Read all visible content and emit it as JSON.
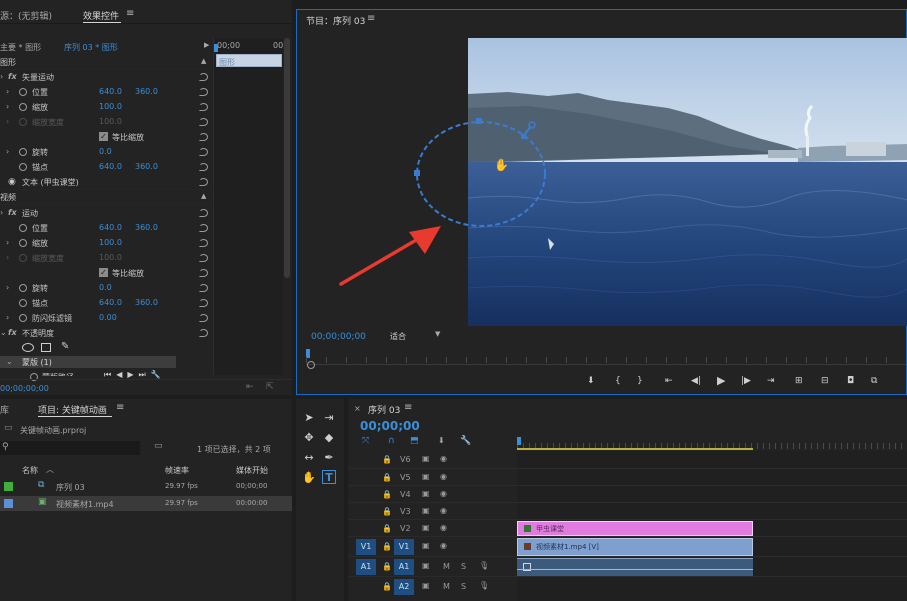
{
  "colors": {
    "bg": "#1d1d1d",
    "panel": "#232323",
    "accent_blue": "#3b8fd9",
    "clip_pink": "#e07ce0",
    "clip_blue": "#7f9fcf",
    "arrow_red": "#e83a2e",
    "selection_outline": "#1c6bc2"
  },
  "source_panel": {
    "tab_source": "源：(无剪辑)",
    "tab_effect_controls": "效果控件",
    "breadcrumb_main": "主要 * 图形",
    "breadcrumb_seq": "序列 03 * 图形",
    "ruler_start": "00;00",
    "ruler_end": "00",
    "clip_label": "图形",
    "section_graphic": "图形",
    "vector_motion": {
      "label": "矢量运动",
      "position_label": "位置",
      "position_x": "640.0",
      "position_y": "360.0",
      "scale_label": "缩放",
      "scale_value": "100.0",
      "scale_width_label": "缩放宽度",
      "scale_width_value": "100.0",
      "uniform_scale_label": "等比缩放",
      "rotation_label": "旋转",
      "rotation_value": "0.0",
      "anchor_label": "锚点",
      "anchor_x": "640.0",
      "anchor_y": "360.0"
    },
    "text_layer": "文本 (甲虫课堂)",
    "section_video": "视频",
    "motion": {
      "label": "运动",
      "position_label": "位置",
      "position_x": "640.0",
      "position_y": "360.0",
      "scale_label": "缩放",
      "scale_value": "100.0",
      "scale_width_label": "缩放宽度",
      "scale_width_value": "100.0",
      "uniform_scale_label": "等比缩放",
      "rotation_label": "旋转",
      "rotation_value": "0.0",
      "anchor_label": "锚点",
      "anchor_x": "640.0",
      "anchor_y": "360.0",
      "flicker_label": "防闪烁滤镜",
      "flicker_value": "0.00"
    },
    "opacity_label": "不透明度",
    "mask_label": "蒙版 (1)",
    "mask_path_label": "蒙版路径",
    "timecode": "00;00;00;00"
  },
  "program_panel": {
    "title": "节目：序列 03",
    "timecode": "00;00;00;00",
    "fit_option": "适合"
  },
  "project_panel": {
    "tab_lib": "库",
    "tab_project": "项目: 关键帧动画",
    "project_file": "关键帧动画.prproj",
    "selection_info": "1 项已选择，共 2 项",
    "col_name": "名称",
    "col_fps": "帧速率",
    "col_start": "媒体开始",
    "items": [
      {
        "name": "序列 03",
        "fps": "29.97 fps",
        "start": "00;00;00",
        "color": "#3fae3f"
      },
      {
        "name": "视频素材1.mp4",
        "fps": "29.97 fps",
        "start": "00:00:00",
        "color": "#5b8fd6"
      }
    ]
  },
  "timeline_panel": {
    "title": "序列 03",
    "timecode": "00;00;00",
    "tracks": [
      {
        "label": "V6"
      },
      {
        "label": "V5"
      },
      {
        "label": "V4"
      },
      {
        "label": "V3"
      },
      {
        "label": "V2"
      },
      {
        "label": "V1"
      },
      {
        "label": "A1"
      },
      {
        "label": "A2"
      }
    ],
    "source_v1": "V1",
    "source_a1": "A1",
    "clip_v2": "甲虫课堂",
    "clip_v1": "视频素材1.mp4 [V]",
    "btn_m": "M",
    "btn_s": "S"
  }
}
